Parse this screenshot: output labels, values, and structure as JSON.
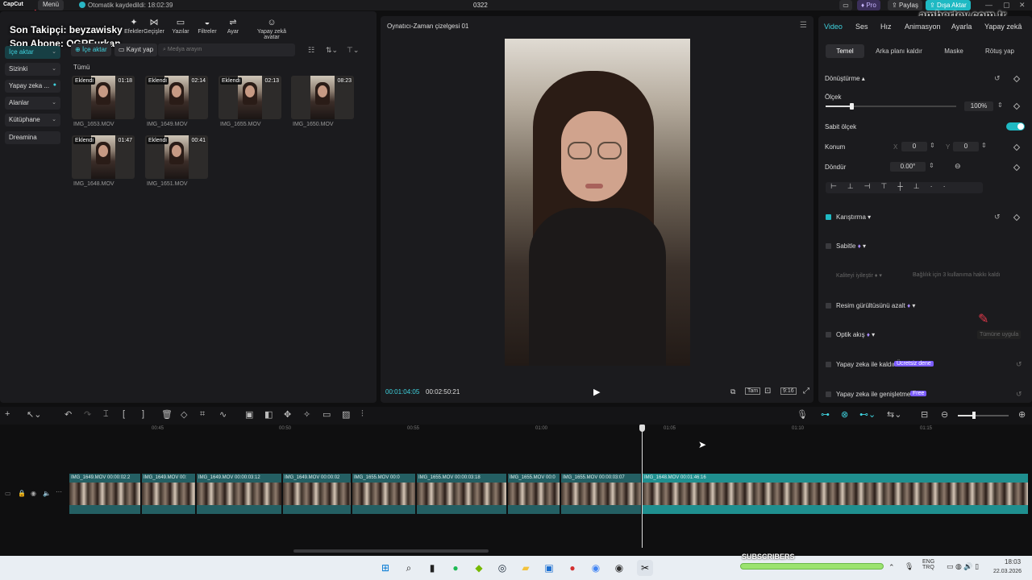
{
  "titlebar": {
    "app": "CapCut",
    "menu": "Menü",
    "autosave": "Otomatik kaydedildi: 18:02:39",
    "project": "0322",
    "pro": "Pro",
    "share": "Paylaş",
    "export": "Dışa Aktar"
  },
  "watermark": {
    "site": "ambertey.com.tr",
    "eirene": "eeirene"
  },
  "overlay": {
    "follower": "Son Takipçi: beyzawisky",
    "subscriber": "Son Abone: OGRFurkan"
  },
  "tools": [
    {
      "label": "Efektler",
      "icon": "✦"
    },
    {
      "label": "Geçişler",
      "icon": "⋈"
    },
    {
      "label": "Yazılar",
      "icon": "▭"
    },
    {
      "label": "Filtreler",
      "icon": "◒"
    },
    {
      "label": "Ayar",
      "icon": "⇌"
    },
    {
      "label": "Yapay zekâ avatar",
      "icon": "☺"
    }
  ],
  "media": {
    "import_nav": "İçe aktar",
    "nav": [
      "Sizinki",
      "Yapay zeka ...",
      "Alanlar",
      "Kütüphane",
      "Dreamina"
    ],
    "import_btn": "İçe aktar",
    "record_btn": "Kayıt yap",
    "search_placeholder": "Medya arayın",
    "all": "Tümü",
    "added": "Eklendi",
    "items": [
      {
        "name": "IMG_1653.MOV",
        "dur": "01:18"
      },
      {
        "name": "IMG_1649.MOV",
        "dur": "02:14"
      },
      {
        "name": "IMG_1655.MOV",
        "dur": "02:13"
      },
      {
        "name": "IMG_1650.MOV",
        "dur": "08:23"
      },
      {
        "name": "IMG_1648.MOV",
        "dur": "01:47"
      },
      {
        "name": "IMG_1651.MOV",
        "dur": "00:41"
      }
    ]
  },
  "player": {
    "title": "Oynatıcı-Zaman çizelgesi 01",
    "current": "00:01:04:05",
    "total": "00:02:50:21",
    "full": "Tam",
    "ratio": "9:16"
  },
  "right": {
    "tabs": [
      "Video",
      "Ses",
      "Hız",
      "Animasyon",
      "Ayarla",
      "Yapay zekâ"
    ],
    "subtabs": [
      "Temel",
      "Arka planı kaldır",
      "Maske",
      "Rötuş yap"
    ],
    "transform": "Dönüştürme",
    "scale": "Ölçek",
    "scale_val": "100%",
    "fixed_scale": "Sabit ölçek",
    "position": "Konum",
    "x_label": "X",
    "x": "0",
    "y_label": "Y",
    "y": "0",
    "rotate": "Döndür",
    "rotate_val": "0.00°",
    "blend": "Karıştırma",
    "stabilize": "Sabitle",
    "quality": "Kaliteyi iyileştir",
    "quality_hint": "Bağlılık için 3 kullanıma hakkı kaldı",
    "noise": "Resim gürültüsünü azalt",
    "optical": "Optik akış",
    "optical_apply": "Tümüne uygula",
    "ai_remove": "Yapay zeka ile kaldır",
    "free_try": "Ücretsiz dene",
    "ai_expand": "Yapay zeka ile genişletme",
    "free": "Free"
  },
  "timeline": {
    "ticks": [
      "00:45",
      "00:50",
      "00:55",
      "01:00",
      "01:05",
      "01:10",
      "01:15"
    ],
    "clips": [
      {
        "name": "IMG_1649.MOV",
        "dur": "00:00:02:2"
      },
      {
        "name": "IMG_1649.MOV",
        "dur": "00:"
      },
      {
        "name": "IMG_1649.MOV",
        "dur": "00:00:03:12"
      },
      {
        "name": "IMG_1649.MOV",
        "dur": "00:00:02"
      },
      {
        "name": "IMG_1655.MOV",
        "dur": "00:0"
      },
      {
        "name": "IMG_1655.MOV",
        "dur": "00:00:03:18"
      },
      {
        "name": "IMG_1655.MOV",
        "dur": "00:0"
      },
      {
        "name": "IMG_1655.MOV",
        "dur": "00:00:03:07"
      },
      {
        "name": "IMG_1648.MOV",
        "dur": "00:01:46:16"
      }
    ]
  },
  "taskbar": {
    "subscribers": "SUBSCRIBERS",
    "lang": "ENG TRQ",
    "time": "18:03",
    "date": "22.03.2026"
  },
  "colors": {
    "accent": "#3fd3df",
    "export": "#1fb9c3",
    "clip": "#245f63"
  }
}
